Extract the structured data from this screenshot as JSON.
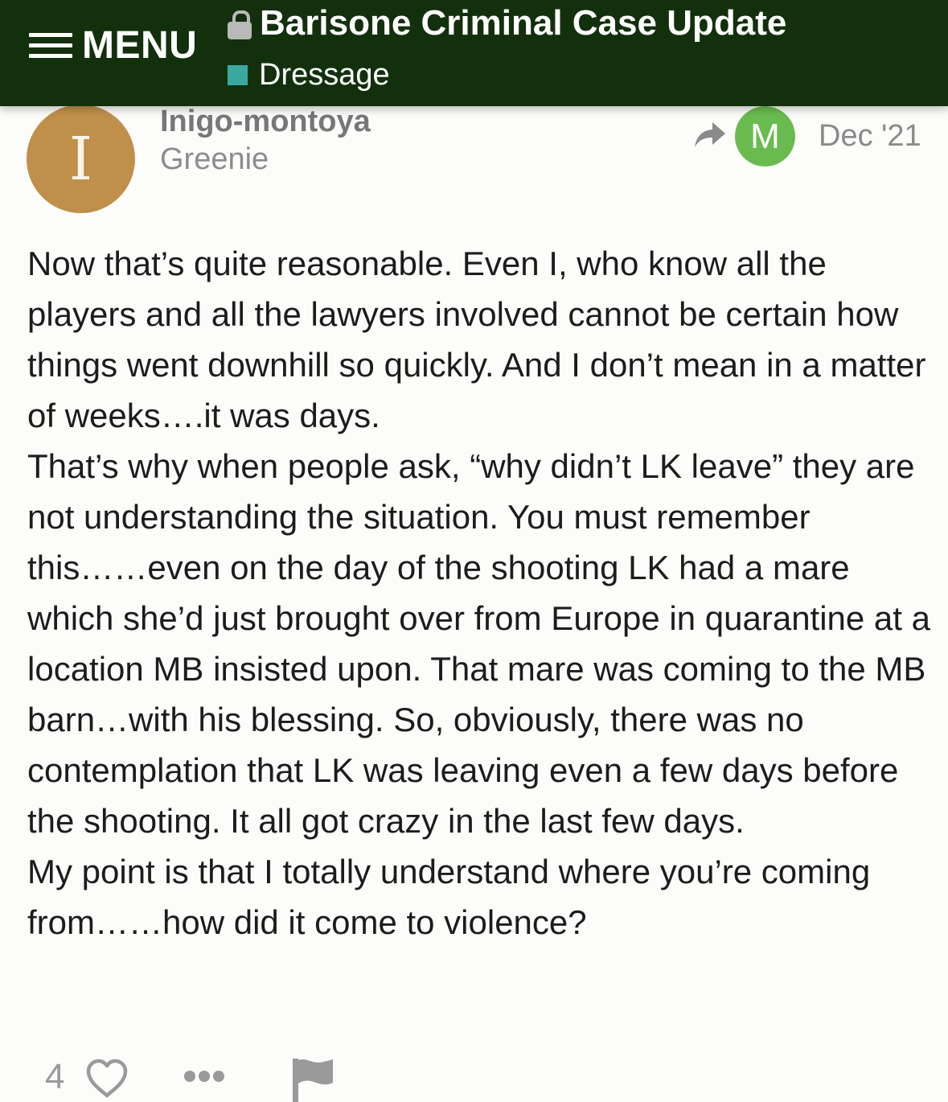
{
  "header": {
    "menu_label": "MENU",
    "topic_title": "Barisone Criminal Case Update",
    "category": "Dressage",
    "category_color": "#3aa8a0",
    "background_color": "#13300d"
  },
  "post": {
    "avatar_letter": "I",
    "avatar_color": "#c0904a",
    "username": "Inigo-montoya",
    "user_title": "Greenie",
    "reply_to_avatar_letter": "M",
    "reply_to_avatar_color": "#6abb4f",
    "date": "Dec '21",
    "paragraphs": [
      "Now that’s quite reasonable. Even I, who know all the players and all the lawyers involved cannot be certain how things went downhill so quickly. And I don’t mean in a matter of weeks….it was days.",
      "That’s why when people ask, “why didn’t LK leave” they are not understanding the situation. You must remember this……even on the day of the shooting LK had a mare which she’d just brought over from Europe in quarantine at a location MB insisted upon. That mare was coming to the MB barn…with his blessing. So, obviously, there was no contemplation that LK was leaving even a few days before the shooting. It all got crazy in the last few days.",
      "My point is that I totally understand where you’re coming from……how did it come to violence?"
    ]
  },
  "actions": {
    "like_count": "4"
  },
  "icons": {
    "menu": "hamburger-icon",
    "lock": "lock-icon",
    "reply": "reply-arrow-icon",
    "like": "heart-icon",
    "more": "more-dots-icon",
    "flag": "flag-icon"
  }
}
